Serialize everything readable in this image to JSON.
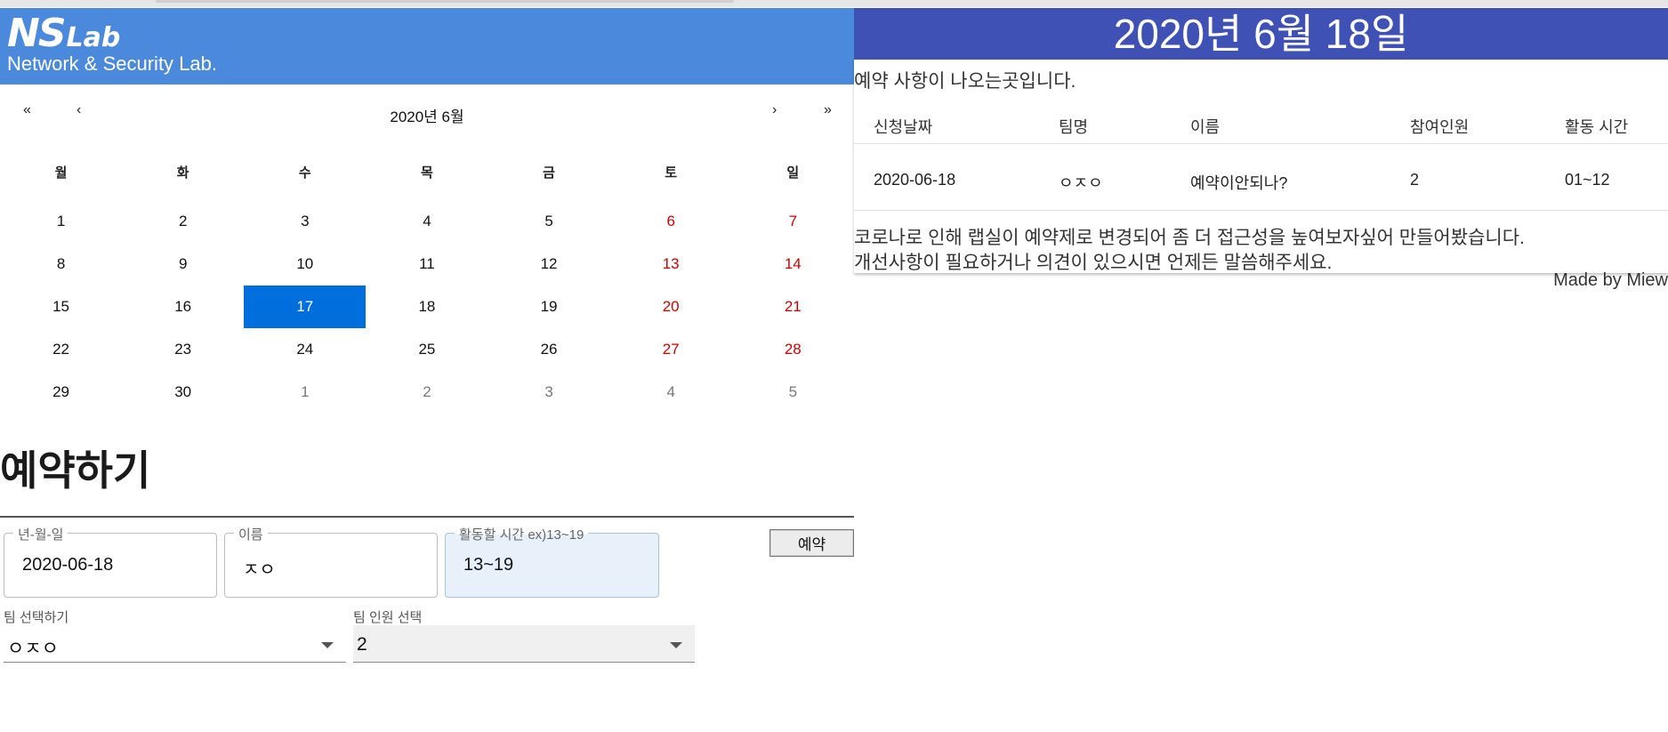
{
  "logo": {
    "mark": "NS",
    "mark_suffix": "Lab",
    "subtitle": "Network & Security Lab."
  },
  "calendar": {
    "title": "2020년 6월",
    "nav": {
      "prev_year": "«",
      "prev_month": "‹",
      "next_month": "›",
      "next_year": "»"
    },
    "weekdays": [
      "월",
      "화",
      "수",
      "목",
      "금",
      "토",
      "일"
    ],
    "weeks": [
      [
        "1",
        "2",
        "3",
        "4",
        "5",
        "6",
        "7"
      ],
      [
        "8",
        "9",
        "10",
        "11",
        "12",
        "13",
        "14"
      ],
      [
        "15",
        "16",
        "17",
        "18",
        "19",
        "20",
        "21"
      ],
      [
        "22",
        "23",
        "24",
        "25",
        "26",
        "27",
        "28"
      ],
      [
        "29",
        "30",
        "1",
        "2",
        "3",
        "4",
        "5"
      ]
    ],
    "selected": "17"
  },
  "reservation": {
    "heading": "예약하기",
    "date_field": {
      "label": "년-월-일",
      "value": "2020-06-18"
    },
    "name_field": {
      "label": "이름",
      "value": "ㅈㅇ"
    },
    "time_field": {
      "label": "활동할 시간 ex)13~19",
      "value": "13~19"
    },
    "submit_label": "예약",
    "team_select": {
      "label": "팀 선택하기",
      "value": "ㅇㅈㅇ"
    },
    "members_select": {
      "label": "팀 인원 선택",
      "value": "2"
    }
  },
  "status": {
    "date_header": "2020년 6월 18일",
    "subtitle": "예약 사항이 나오는곳입니다.",
    "columns": [
      "신청날짜",
      "팀명",
      "이름",
      "참여인원",
      "활동 시간"
    ],
    "rows": [
      [
        "2020-06-18",
        "ㅇㅈㅇ",
        "예약이안되나?",
        "2",
        "01~12"
      ]
    ],
    "notice_line1": "코로나로 인해 랩실이 예약제로 변경되어 좀 더 접근성을 높여보자싶어 만들어봤습니다.",
    "notice_line2": "개선사항이 필요하거나 의견이 있으시면 언제든 말씀해주세요.",
    "made_by": "Made by Miew"
  },
  "colors": {
    "header_blue": "#4a89dc",
    "date_header_indigo": "#3f51b5",
    "selected_day": "#006edc",
    "weekend_red": "#d10000"
  }
}
